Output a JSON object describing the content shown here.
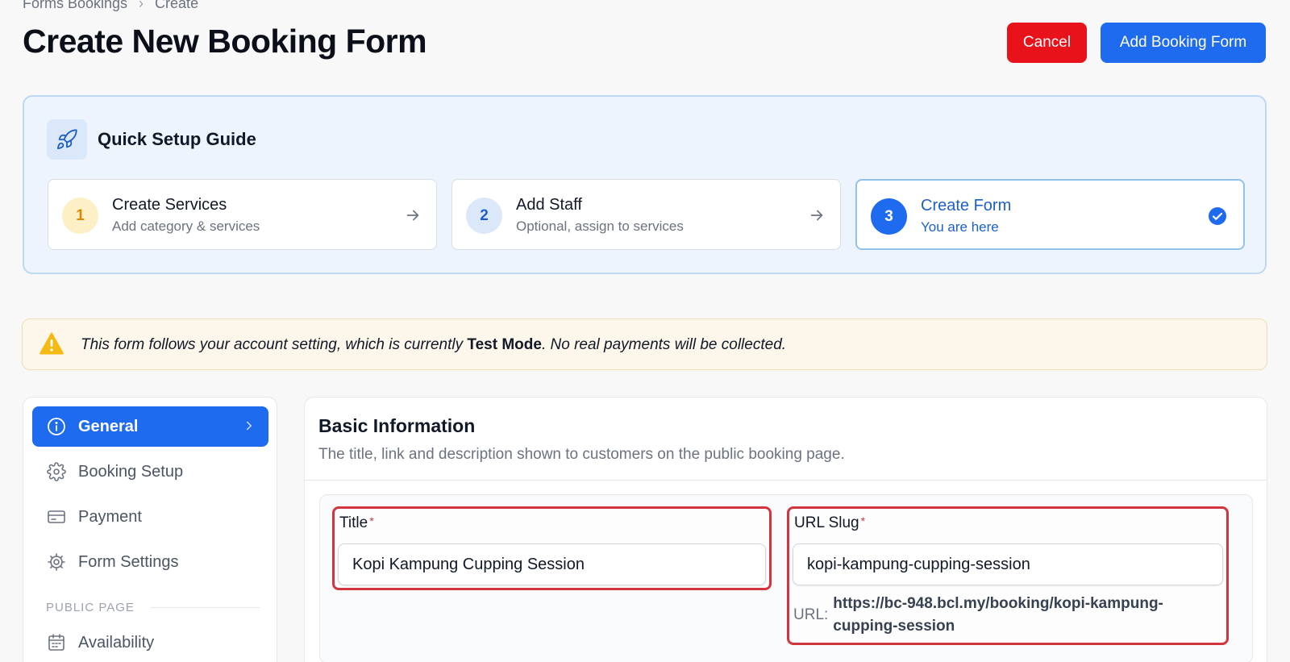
{
  "breadcrumb": {
    "items": [
      "Forms Bookings",
      "Create"
    ]
  },
  "page": {
    "title": "Create New Booking Form"
  },
  "actions": {
    "cancel_label": "Cancel",
    "add_label": "Add Booking Form"
  },
  "guide": {
    "title": "Quick Setup Guide",
    "steps": [
      {
        "number": "1",
        "title": "Create Services",
        "subtitle": "Add category & services"
      },
      {
        "number": "2",
        "title": "Add Staff",
        "subtitle": "Optional, assign to services"
      },
      {
        "number": "3",
        "title": "Create Form",
        "subtitle": "You are here"
      }
    ]
  },
  "notice": {
    "text_before": "This form follows your account setting, which is currently ",
    "mode": "Test Mode",
    "text_after": ". No real payments will be collected."
  },
  "sidebar": {
    "items": [
      {
        "label": "General"
      },
      {
        "label": "Booking Setup"
      },
      {
        "label": "Payment"
      },
      {
        "label": "Form Settings"
      }
    ],
    "section_label": "PUBLIC PAGE",
    "section_items": [
      {
        "label": "Availability"
      }
    ]
  },
  "main": {
    "title": "Basic Information",
    "subtitle": "The title, link and description shown to customers on the public booking page.",
    "title_field": {
      "label": "Title",
      "required_mark": "*",
      "value": "Kopi Kampung Cupping Session"
    },
    "slug_field": {
      "label": "URL Slug",
      "required_mark": "*",
      "value": "kopi-kampung-cupping-session",
      "url_prefix": "URL:",
      "url_value_line1": "https://bc-948.bcl.my/booking/kopi-kampung-",
      "url_value_line2": "cupping-session"
    }
  },
  "colors": {
    "accent": "#1f6bf0",
    "danger": "#e8121b",
    "highlight_border": "#d1363f"
  }
}
